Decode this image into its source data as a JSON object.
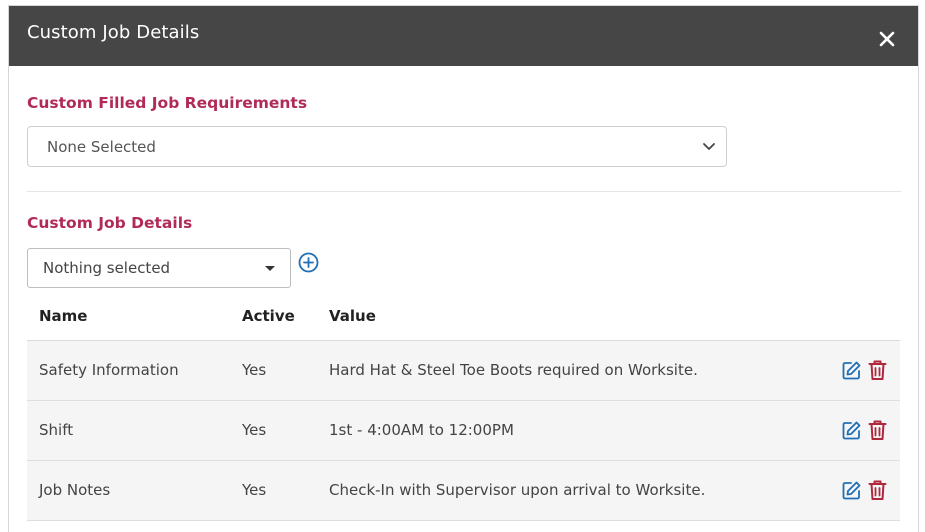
{
  "modal": {
    "title": "Custom Job Details"
  },
  "filled_requirements": {
    "label": "Custom Filled Job Requirements",
    "selected": "None Selected"
  },
  "custom_details": {
    "label": "Custom Job Details",
    "dropdown_value": "Nothing selected"
  },
  "table": {
    "headers": [
      "Name",
      "Active",
      "Value"
    ],
    "rows": [
      {
        "name": "Safety Information",
        "active": "Yes",
        "value": "Hard Hat & Steel Toe Boots required on Worksite."
      },
      {
        "name": "Shift",
        "active": "Yes",
        "value": "1st - 4:00AM to 12:00PM"
      },
      {
        "name": "Job Notes",
        "active": "Yes",
        "value": "Check-In with Supervisor upon arrival to Worksite."
      }
    ]
  },
  "colors": {
    "header_bg": "#464646",
    "section_label": "#b02a5a",
    "edit_icon": "#1f6fb5",
    "delete_icon": "#b0263a",
    "row_bg": "#f5f5f5"
  },
  "icons": {
    "close": "close-icon",
    "chevron": "chevron-down-icon",
    "add": "add-circle-icon",
    "edit": "edit-icon",
    "delete": "trash-icon"
  }
}
